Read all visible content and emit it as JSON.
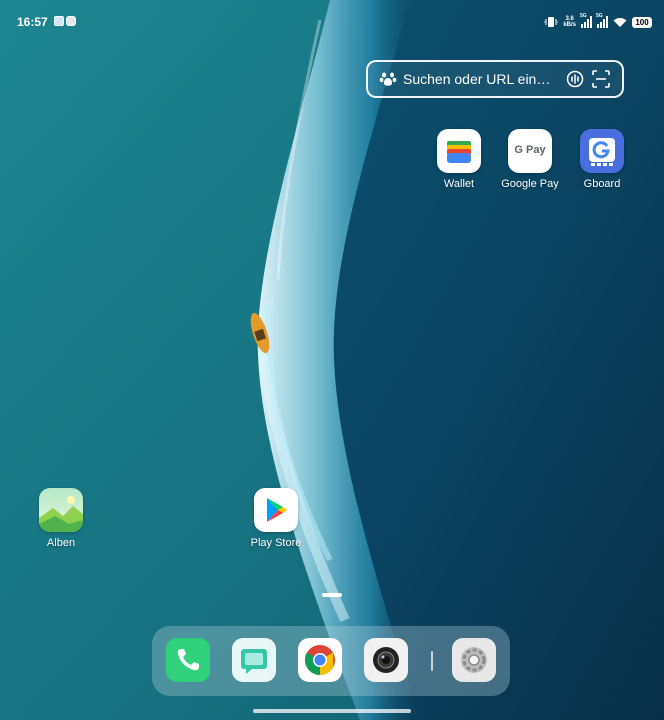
{
  "status_bar": {
    "time": "16:57",
    "net_speed_value": "3.6",
    "net_speed_unit": "kB/s",
    "signal_1_tag": "5G",
    "signal_2_tag": "5G",
    "battery": "100"
  },
  "search_widget": {
    "placeholder": "Suchen oder URL ein…"
  },
  "apps": {
    "wallet": "Wallet",
    "google_pay": "Google Pay",
    "gpay_logo_text": "G Pay",
    "gboard": "Gboard",
    "alben": "Alben",
    "play_store": "Play Store"
  },
  "dock": {
    "apps": [
      "phone-icon",
      "messages-icon",
      "chrome-icon",
      "camera-icon",
      "settings-icon"
    ]
  },
  "colors": {
    "ocean_light": "#1f8a93",
    "ocean_deep": "#0a3d5c",
    "phone_green": "#2fd27a",
    "gboard_blue": "#4a6ee0"
  }
}
